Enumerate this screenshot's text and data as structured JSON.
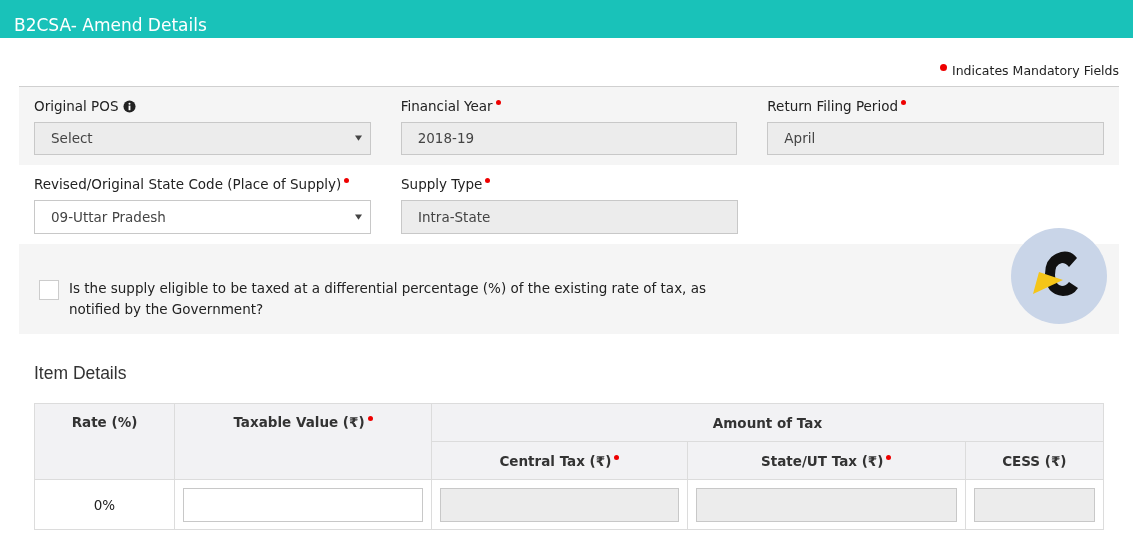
{
  "header": {
    "title": "B2CSA- Amend Details"
  },
  "mandatory_note": "Indicates Mandatory Fields",
  "field_rows": [
    [
      {
        "label": "Original POS",
        "info": true,
        "required": false,
        "kind": "select",
        "value": "Select",
        "disabled": true
      },
      {
        "label": "Financial Year",
        "info": false,
        "required": true,
        "kind": "text",
        "value": "2018-19",
        "disabled": true
      },
      {
        "label": "Return Filing Period",
        "info": false,
        "required": true,
        "kind": "text",
        "value": "April",
        "disabled": true
      }
    ],
    [
      {
        "label": "Revised/Original State Code (Place of Supply)",
        "info": false,
        "required": true,
        "kind": "select",
        "value": "09-Uttar Pradesh",
        "disabled": false
      },
      {
        "label": "Supply Type",
        "info": false,
        "required": true,
        "kind": "text",
        "value": "Intra-State",
        "disabled": true
      }
    ]
  ],
  "differential": {
    "label": "Is the supply eligible to be taxed at a differential percentage (%) of the existing rate of tax, as notified by the Government?",
    "checked": false
  },
  "item_details": {
    "heading": "Item Details",
    "columns": [
      {
        "label": "Rate (%)",
        "required": false
      },
      {
        "label": "Taxable Value (₹)",
        "required": true
      }
    ],
    "group": {
      "label": "Amount of Tax",
      "columns": [
        {
          "label": "Central Tax (₹)",
          "required": true
        },
        {
          "label": "State/UT Tax (₹)",
          "required": true
        },
        {
          "label": "CESS (₹)",
          "required": false
        }
      ]
    },
    "rows": [
      {
        "rate": "0%",
        "inputs": [
          {
            "disabled": false
          },
          {
            "disabled": true
          },
          {
            "disabled": true
          },
          {
            "disabled": true
          }
        ]
      }
    ]
  }
}
